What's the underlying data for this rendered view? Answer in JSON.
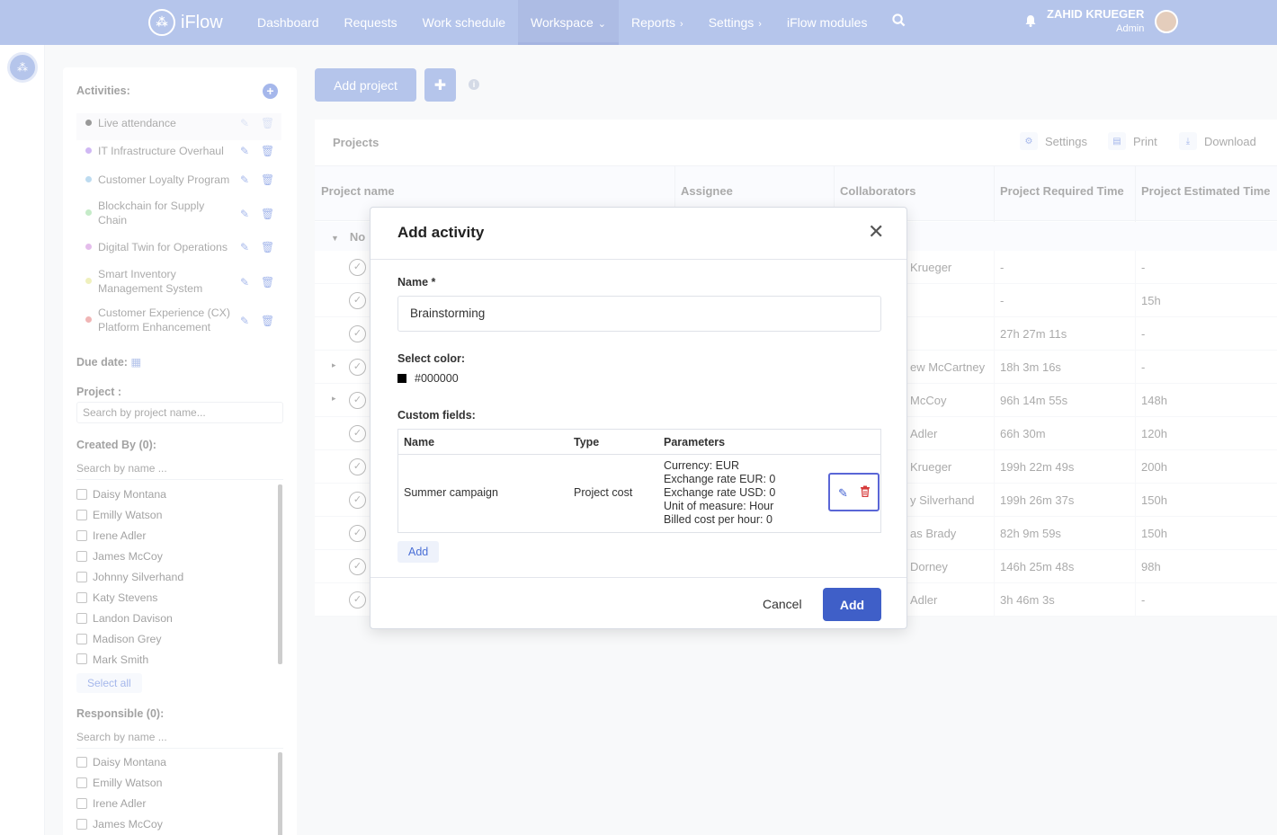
{
  "topbar": {
    "logo_text": "iFlow",
    "logo_icon": "people-group-icon",
    "nav": [
      {
        "label": "Dashboard",
        "chevron": ""
      },
      {
        "label": "Requests",
        "chevron": ""
      },
      {
        "label": "Work schedule",
        "chevron": ""
      },
      {
        "label": "Workspace",
        "chevron": "⌄"
      },
      {
        "label": "Reports",
        "chevron": "›"
      },
      {
        "label": "Settings",
        "chevron": "›"
      },
      {
        "label": "iFlow modules",
        "chevron": ""
      }
    ],
    "user_name": "ZAHID KRUEGER",
    "user_role": "Admin"
  },
  "sidebar": {
    "activities_title": "Activities:",
    "activities": [
      {
        "label": "Live attendance",
        "color": "#333333"
      },
      {
        "label": "IT Infrastructure Overhaul",
        "color": "#a070e8"
      },
      {
        "label": "Customer Loyalty Program",
        "color": "#7ab6e0"
      },
      {
        "label": "Blockchain for Supply Chain",
        "color": "#8ad690"
      },
      {
        "label": "Digital Twin for Operations",
        "color": "#c87ad6"
      },
      {
        "label": "Smart Inventory Management System",
        "color": "#dfe07a"
      },
      {
        "label": "Customer Experience (CX) Platform Enhancement",
        "color": "#e06a6a"
      }
    ],
    "due_date_label": "Due date:",
    "project_label": "Project :",
    "project_placeholder": "Search by project name...",
    "created_by_label": "Created By (0):",
    "created_search": "Search by name ...",
    "created_people": [
      "Daisy Montana",
      "Emilly Watson",
      "Irene Adler",
      "James McCoy",
      "Johnny Silverhand",
      "Katy Stevens",
      "Landon Davison",
      "Madison Grey",
      "Mark Smith"
    ],
    "select_all": "Select all",
    "responsible_label": "Responsible (0):",
    "responsible_search": "Search by name ...",
    "responsible_people": [
      "Daisy Montana",
      "Emilly Watson",
      "Irene Adler",
      "James McCoy"
    ]
  },
  "toolbar": {
    "add_project": "Add project",
    "plus": "✚",
    "info": "i"
  },
  "projects": {
    "title": "Projects",
    "settings": "Settings",
    "print": "Print",
    "download": "Download",
    "columns": [
      "Project name",
      "Assignee",
      "Collaborators",
      "Project Required Time",
      "Project Estimated Time"
    ],
    "group_label": "No",
    "rows": [
      {
        "collab": "Krueger",
        "req": "-",
        "est": "-",
        "exp": ""
      },
      {
        "collab": "",
        "req": "-",
        "est": "15h",
        "exp": ""
      },
      {
        "collab": "",
        "req": "27h 27m 11s",
        "est": "-",
        "exp": ""
      },
      {
        "collab": "ew McCartney",
        "req": "18h 3m 16s",
        "est": "-",
        "exp": "▸"
      },
      {
        "collab": "McCoy",
        "req": "96h 14m 55s",
        "est": "148h",
        "exp": "▸"
      },
      {
        "collab": "Adler",
        "req": "66h 30m",
        "est": "120h",
        "exp": ""
      },
      {
        "collab": "Krueger",
        "req": "199h 22m 49s",
        "est": "200h",
        "exp": ""
      },
      {
        "collab": "y Silverhand",
        "req": "199h 26m 37s",
        "est": "150h",
        "exp": ""
      },
      {
        "collab": "as Brady",
        "req": "82h 9m 59s",
        "est": "150h",
        "exp": ""
      },
      {
        "collab": "Dorney",
        "req": "146h 25m 48s",
        "est": "98h",
        "exp": ""
      },
      {
        "collab": "Adler",
        "req": "3h 46m 3s",
        "est": "-",
        "exp": ""
      }
    ]
  },
  "modal": {
    "title": "Add activity",
    "name_label": "Name *",
    "name_value": "Brainstorming",
    "color_label": "Select color:",
    "color_value": "#000000",
    "custom_fields_label": "Custom fields:",
    "cf_columns": [
      "Name",
      "Type",
      "Parameters"
    ],
    "cf_row": {
      "name": "Summer campaign",
      "type": "Project cost",
      "params": [
        "Currency: EUR",
        "Exchange rate EUR: 0",
        "Exchange rate USD: 0",
        "Unit of measure: Hour",
        "Billed cost per hour: 0"
      ]
    },
    "add_field": "Add",
    "cancel": "Cancel",
    "submit": "Add"
  }
}
